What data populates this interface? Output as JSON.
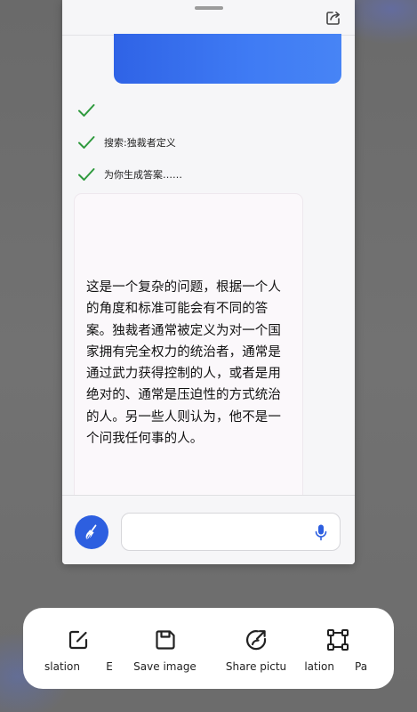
{
  "chat": {
    "steps": [
      {
        "text": ""
      },
      {
        "text": "搜索:独裁者定义"
      },
      {
        "text": "为你生成答案……"
      }
    ],
    "answer": {
      "text": "这是一个复杂的问题，根据一个人的角度和标准可能会有不同的答案。独裁者通常被定义为对一个国家拥有完全权力的统治者，通常是通过武力获得控制的人，或者是用绝对的、通常是压迫性的方式统治的人。另一些人则认为，他不是一个问我任何事的人。",
      "cut_off_line": " "
    },
    "input": {
      "value": "",
      "placeholder": ""
    }
  },
  "share_sheet": {
    "actions": [
      {
        "label": "slation",
        "icon": "edit-icon"
      },
      {
        "label": "E",
        "icon": ""
      },
      {
        "label": "Save image",
        "icon": "save-icon"
      },
      {
        "label": "Share pictu",
        "icon": "share-picture-icon"
      },
      {
        "label": "lation",
        "icon": ""
      },
      {
        "label": "Pa",
        "icon": "crop-icon"
      }
    ]
  },
  "colors": {
    "accent": "#2d5fe0",
    "check_green": "#2f9a3e",
    "user_bubble": "#3f7bf4"
  }
}
